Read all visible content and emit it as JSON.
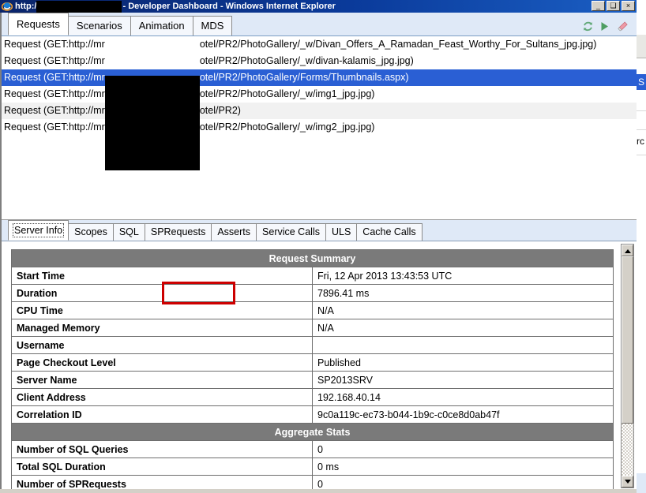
{
  "window": {
    "title_url": "http:/",
    "title_suffix": "- Developer Dashboard - Windows Internet Explorer",
    "minimize_label": "_",
    "maximize_label": "❑",
    "close_label": "×",
    "app_icon": "internet-explorer-icon"
  },
  "tabs": {
    "items": [
      {
        "label": "Requests",
        "active": true
      },
      {
        "label": "Scenarios",
        "active": false
      },
      {
        "label": "Animation",
        "active": false
      },
      {
        "label": "MDS",
        "active": false
      }
    ],
    "icons": [
      {
        "name": "refresh-icon",
        "color": "#5aa06e"
      },
      {
        "name": "play-icon",
        "color": "#4e9e62"
      },
      {
        "name": "eraser-icon",
        "color": "#e8909c"
      }
    ]
  },
  "requests": {
    "prefix": "Request (GET:http://mr",
    "rows": [
      {
        "suffix": "otel/PR2/PhotoGallery/_w/Divan_Offers_A_Ramadan_Feast_Worthy_For_Sultans_jpg.jpg)",
        "selected": false
      },
      {
        "suffix": "otel/PR2/PhotoGallery/_w/divan-kalamis_jpg.jpg)",
        "selected": false
      },
      {
        "suffix": "otel/PR2/PhotoGallery/Forms/Thumbnails.aspx)",
        "selected": true
      },
      {
        "suffix": "otel/PR2/PhotoGallery/_w/img1_jpg.jpg)",
        "selected": false
      },
      {
        "suffix": "otel/PR2)",
        "selected": false
      },
      {
        "suffix": "otel/PR2/PhotoGallery/_w/img2_jpg.jpg)",
        "selected": false
      }
    ]
  },
  "detail_tabs": {
    "items": [
      {
        "label": "Server Info",
        "active": true
      },
      {
        "label": "Scopes",
        "active": false
      },
      {
        "label": "SQL",
        "active": false
      },
      {
        "label": "SPRequests",
        "active": false
      },
      {
        "label": "Asserts",
        "active": false
      },
      {
        "label": "Service Calls",
        "active": false
      },
      {
        "label": "ULS",
        "active": false
      },
      {
        "label": "Cache Calls",
        "active": false
      }
    ]
  },
  "server_info": {
    "section_request_summary": "Request Summary",
    "section_aggregate_stats": "Aggregate Stats",
    "request_summary_rows": [
      {
        "label": "Start Time",
        "value": "Fri, 12 Apr 2013 13:43:53 UTC"
      },
      {
        "label": "Duration",
        "value": "7896.41 ms",
        "highlighted": true
      },
      {
        "label": "CPU Time",
        "value": "N/A"
      },
      {
        "label": "Managed Memory",
        "value": "N/A"
      },
      {
        "label": "Username",
        "value": ""
      },
      {
        "label": "Page Checkout Level",
        "value": "Published"
      },
      {
        "label": "Server Name",
        "value": "SP2013SRV"
      },
      {
        "label": "Client Address",
        "value": "192.168.40.14"
      },
      {
        "label": "Correlation ID",
        "value": "9c0a119c-ec73-b044-1b9c-c0ce8d0ab47f"
      }
    ],
    "aggregate_stats_rows": [
      {
        "label": "Number of SQL Queries",
        "value": "0"
      },
      {
        "label": "Total SQL Duration",
        "value": "0 ms"
      },
      {
        "label": "Number of SPRequests",
        "value": "0"
      }
    ]
  },
  "annotation": {
    "highlight_color": "#cc0000",
    "target": "7896.41 ms"
  },
  "background": {
    "selected_fragment": "S",
    "text_fragment": "rc"
  }
}
